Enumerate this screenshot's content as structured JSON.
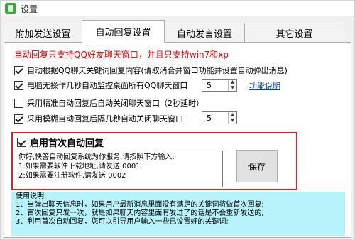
{
  "window": {
    "title": "设置"
  },
  "tabs": [
    {
      "label": "附加发送设置"
    },
    {
      "label": "自动回复设置"
    },
    {
      "label": "自动发言设置"
    },
    {
      "label": "其它设置"
    }
  ],
  "notice": "自动回复只支持QQ好友聊天窗口，并且只支持win7和xp",
  "options": [
    {
      "label": "自动根据QQ聊天关键词回复内容(请取消合并窗口功能并设置自动弹出消息)",
      "checked": true
    },
    {
      "label": "电脑无操作几秒自动监控桌面所有QQ聊天窗口",
      "checked": true,
      "spin_value": "5",
      "link": "功能说明"
    },
    {
      "label": "采用精准自动回复后自动关闭聊天窗口（2秒延时）",
      "checked": false
    },
    {
      "label": "采用模糊自动回复后隔几秒自动关闭聊天窗口",
      "checked": true,
      "spin_value": "5"
    }
  ],
  "first_reply": {
    "label": "启用首次自动回复",
    "checked": true,
    "lines": [
      "你好,快答自动回复系统为你服务,请按照下方输入:",
      "1:如果需要软件下载地址,请发送 0001",
      "2:如果需要注册软件,请发送 0002"
    ],
    "save_label": "保存"
  },
  "help": {
    "lines": [
      "使用说明:",
      "1、当弹出聊天信息时，如果用户最新消息里面没有满足的关键词将做首次回复;",
      "2、首次回复只发一次，就是如果聊天内容里面有发过了的话是不会重新发送的;",
      "3、利用首次自动回复，您可以引导用户输入一些已设置好的关键词;"
    ]
  }
}
